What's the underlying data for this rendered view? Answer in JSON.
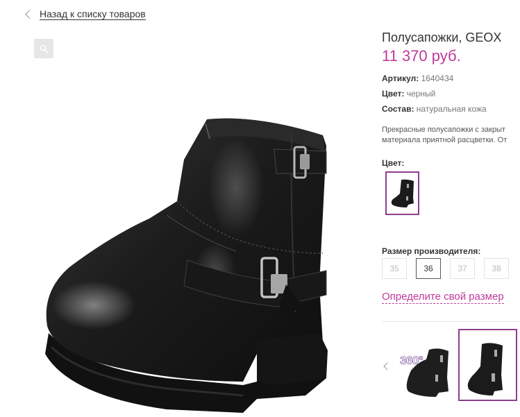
{
  "nav": {
    "back_label": "Назад к списку товаров"
  },
  "product": {
    "title": "Полусапожки, GEOX",
    "price": "11 370 руб.",
    "attributes": [
      {
        "key": "Артикул:",
        "value": "1640434"
      },
      {
        "key": "Цвет:",
        "value": "черный"
      },
      {
        "key": "Состав:",
        "value": "натуральная кожа"
      }
    ],
    "description_lines": [
      "Прекрасные полусапожки с закрыт",
      "материала приятной расцветки. От"
    ]
  },
  "color": {
    "label": "Цвет:"
  },
  "sizes": {
    "label": "Размер производителя:",
    "options": [
      "35",
      "36",
      "37",
      "38"
    ],
    "selected": "36",
    "help_label": "Определите свой размер"
  },
  "thumbnails": {
    "badge_text": "360°"
  },
  "colors": {
    "accent": "#c0399b",
    "selected_border": "#8e3c8f",
    "boot": "#1b1b1b"
  },
  "icons": [
    "chevron-left-icon",
    "search-icon",
    "chevron-left-icon"
  ]
}
